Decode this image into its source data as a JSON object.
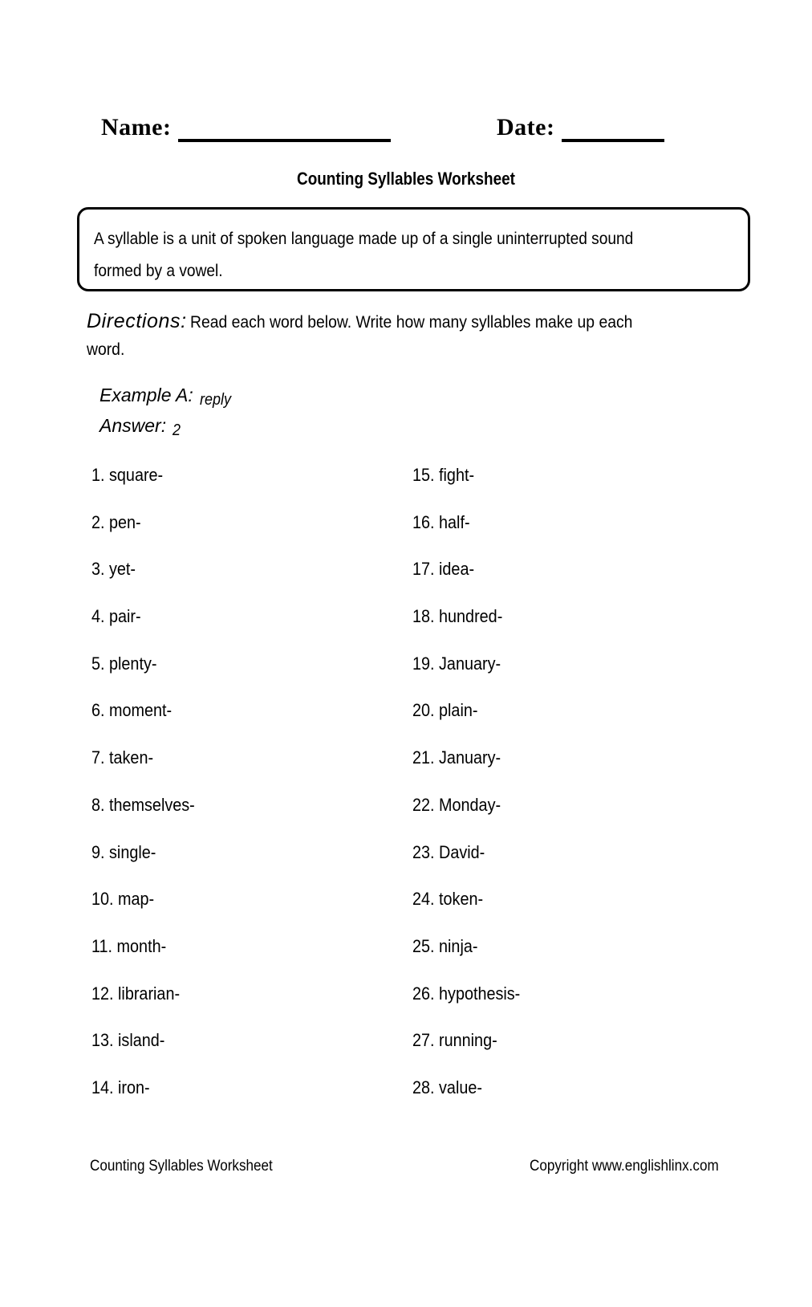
{
  "header": {
    "name_label": "Name:",
    "date_label": "Date:",
    "name_value": "",
    "date_value": ""
  },
  "title": "Counting Syllables Worksheet",
  "definition_box": {
    "text": "A syllable is a unit of spoken language made up of a single uninterrupted sound formed by a vowel."
  },
  "directions": {
    "label": "Directions:",
    "text_line1": "Read each word below. Write how many syllables make up each",
    "text_line2": "word."
  },
  "example": {
    "label": "Example A:",
    "word": "reply",
    "answer_label": "Answer:",
    "answer_value": "2"
  },
  "columns": {
    "left": [
      "1. square-",
      "2. pen-",
      "3. yet-",
      "4. pair-",
      "5. plenty-",
      "6. moment-",
      "7. taken-",
      "8. themselves-",
      "9. single-",
      "10. map-",
      "11. month-",
      "12. librarian-",
      "13. island-",
      "14. iron-"
    ],
    "right": [
      "15. fight-",
      "16. half-",
      "17. idea-",
      "18. hundred-",
      "19. January-",
      "20. plain-",
      "21. January-",
      "22. Monday-",
      "23. David-",
      "24. token-",
      "25. ninja-",
      "26. hypothesis-",
      "27. running-",
      "28. value-"
    ]
  },
  "footer": {
    "left": "Counting Syllables Worksheet",
    "right": "Copyright www.englishlinx.com"
  },
  "colors": {
    "ink": "#000000",
    "paper": "#ffffff"
  }
}
